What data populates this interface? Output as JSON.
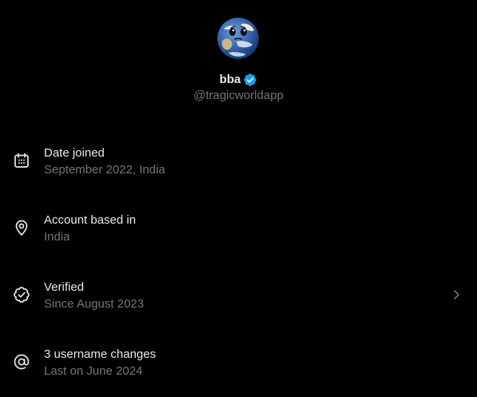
{
  "profile": {
    "avatar": "earth-avatar-icon",
    "display_name": "bba",
    "verified_icon": "verified-badge-icon",
    "handle": "@tragicworldapp"
  },
  "about": [
    {
      "icon": "calendar-icon",
      "title": "Date joined",
      "subtitle": "September 2022, India"
    },
    {
      "icon": "location-pin-icon",
      "title": "Account based in",
      "subtitle": "India"
    },
    {
      "icon": "verified-check-icon",
      "title": "Verified",
      "subtitle": "Since August 2023",
      "chevron": "chevron-right-icon"
    },
    {
      "icon": "at-sign-icon",
      "title": "3 username changes",
      "subtitle": "Last on June 2024"
    }
  ],
  "colors": {
    "background": "#000000",
    "primary_text": "#e7e9ea",
    "secondary_text": "#71767b",
    "verified_blue": "#1d9bf0"
  }
}
